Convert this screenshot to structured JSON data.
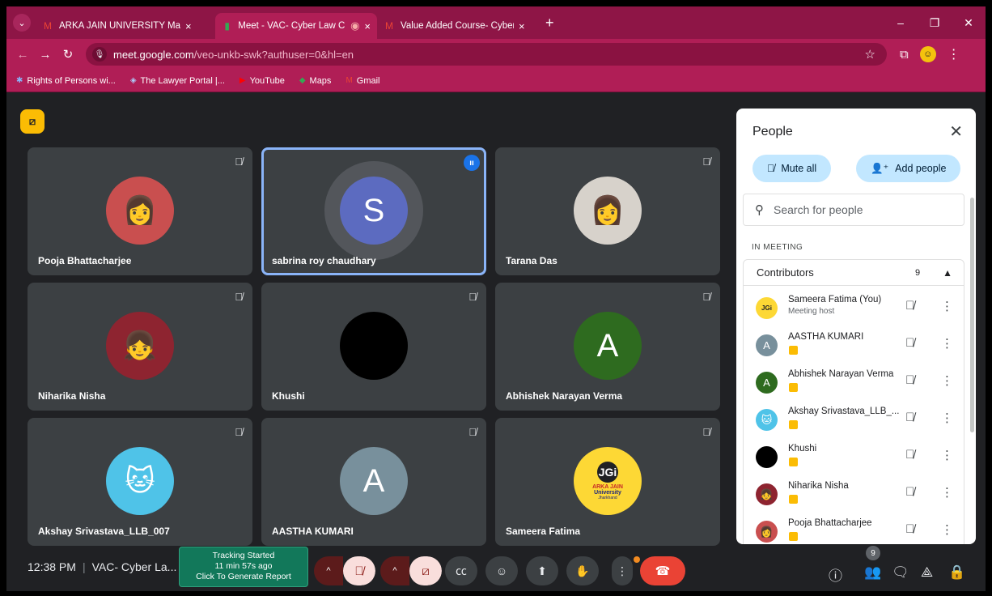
{
  "browser": {
    "tabs": [
      {
        "icon": "gmail-icon",
        "title": "ARKA JAIN UNIVERSITY Mail",
        "active": false
      },
      {
        "icon": "meet-icon",
        "title": "Meet - VAC- Cyber Law Cla:",
        "active": true
      },
      {
        "icon": "gmail-icon",
        "title": "Value Added Course- Cyber La",
        "active": false
      }
    ],
    "url_host": "meet.google.com",
    "url_rest": "/veo-unkb-swk?authuser=0&hl=en",
    "bookmarks": [
      "Rights of Persons wi...",
      "The Lawyer Portal |...",
      "YouTube",
      "Maps",
      "Gmail"
    ]
  },
  "tiles": [
    {
      "name": "Pooja Bhattacharjee",
      "avatar": "photo",
      "color": "#c94f4f"
    },
    {
      "name": "sabrina roy chaudhary",
      "avatar_letter": "S",
      "color": "#5c6bc0",
      "speaking": true
    },
    {
      "name": "Tarana Das",
      "avatar": "photo",
      "color": "#d7d2cb"
    },
    {
      "name": "Niharika Nisha",
      "avatar": "photo",
      "color": "#8e2430"
    },
    {
      "name": "Khushi",
      "avatar": "photo",
      "color": "#000000"
    },
    {
      "name": "Abhishek Narayan Verma",
      "avatar_letter": "A",
      "color": "#2e6b1f"
    },
    {
      "name": "Akshay Srivastava_LLB_007",
      "avatar": "photo",
      "color": "#4fc3e8"
    },
    {
      "name": "AASTHA KUMARI",
      "avatar_letter": "A",
      "color": "#78909c"
    },
    {
      "name": "Sameera Fatima",
      "avatar": "logo",
      "color": "#fdd835"
    }
  ],
  "bottombar": {
    "time": "12:38 PM",
    "meeting_title": "VAC- Cyber La...",
    "tracker": {
      "line1": "Tracking Started",
      "line2": "11 min 57s ago",
      "line3": "Click To Generate Report"
    },
    "people_count": "9"
  },
  "panel": {
    "title": "People",
    "mute_all": "Mute all",
    "add_people": "Add people",
    "search_placeholder": "Search for people",
    "section": "IN MEETING",
    "group_label": "Contributors",
    "group_count": "9",
    "logo_text": "JGi",
    "logo_line1": "ARKA JAIN",
    "logo_line2": "University",
    "logo_line3": "Jharkhand",
    "people": [
      {
        "name": "Sameera Fatima (You)",
        "sub": "Meeting host",
        "color": "#fdd835"
      },
      {
        "name": "AASTHA KUMARI",
        "color": "#78909c",
        "letter": "A"
      },
      {
        "name": "Abhishek Narayan Verma",
        "color": "#2e6b1f",
        "letter": "A"
      },
      {
        "name": "Akshay Srivastava_LLB_...",
        "color": "#4fc3e8"
      },
      {
        "name": "Khushi",
        "color": "#000000"
      },
      {
        "name": "Niharika Nisha",
        "color": "#8e2430"
      },
      {
        "name": "Pooja Bhattacharjee",
        "color": "#c94f4f"
      }
    ]
  }
}
